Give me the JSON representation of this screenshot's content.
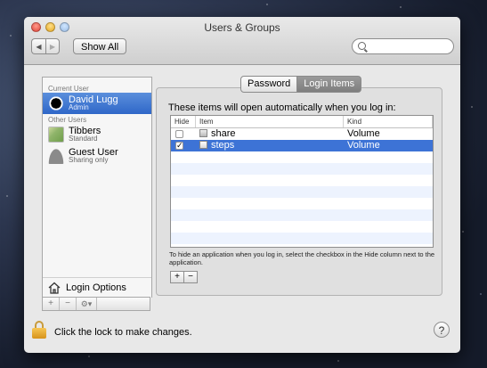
{
  "window": {
    "title": "Users & Groups"
  },
  "toolbar": {
    "back": "◀",
    "forward": "▶",
    "show_all": "Show All",
    "search_placeholder": ""
  },
  "sidebar": {
    "current_user_heading": "Current User",
    "current_user": {
      "name": "David Lugg",
      "role": "Admin"
    },
    "other_users_heading": "Other Users",
    "other_users": [
      {
        "name": "Tibbers",
        "role": "Standard"
      },
      {
        "name": "Guest User",
        "role": "Sharing only"
      }
    ],
    "login_options": "Login Options",
    "tools": {
      "add": "+",
      "remove": "−",
      "action": "⚙▾"
    }
  },
  "tabs": [
    {
      "label": "Password"
    },
    {
      "label": "Login Items"
    }
  ],
  "login_items": {
    "intro": "These items will open automatically when you log in:",
    "columns": {
      "hide": "Hide",
      "item": "Item",
      "kind": "Kind"
    },
    "rows": [
      {
        "checked": "",
        "name": "share",
        "kind": "Volume"
      },
      {
        "checked": "✓",
        "name": "steps",
        "kind": "Volume"
      }
    ],
    "note": "To hide an application when you log in, select the checkbox in the Hide column next to the application.",
    "add": "+",
    "remove": "−"
  },
  "footer": {
    "lock_text": "Click the lock to make changes.",
    "help": "?"
  }
}
